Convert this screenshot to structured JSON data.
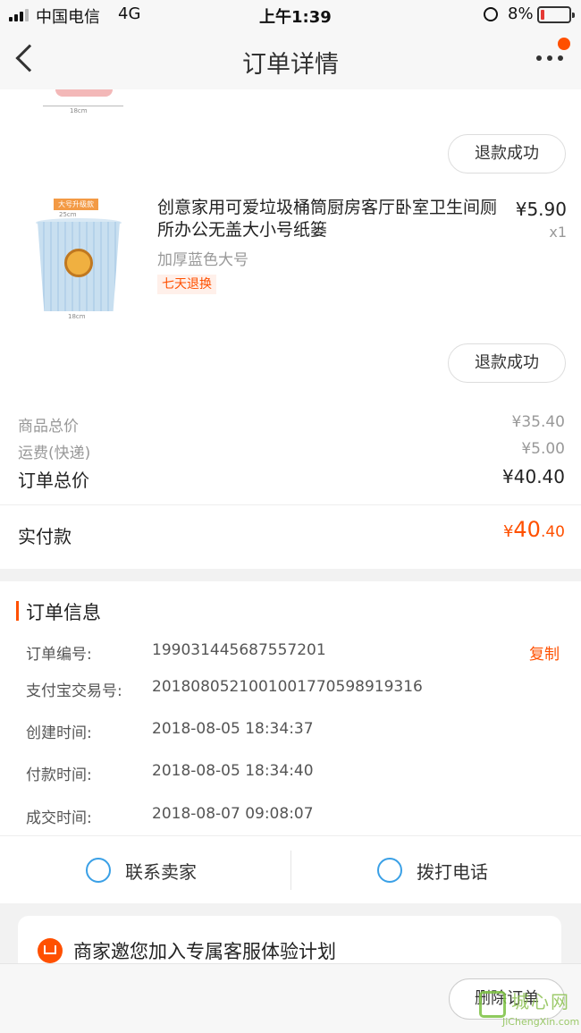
{
  "status": {
    "carrier": "中国电信",
    "network": "4G",
    "time": "上午1:39",
    "battery": "8%"
  },
  "nav": {
    "title": "订单详情"
  },
  "prev_item": {
    "dim": "18cm",
    "refund": "退款成功"
  },
  "item": {
    "title": "创意家用可爱垃圾桶筒厨房客厅卧室卫生间厕所办公无盖大小号纸篓",
    "price": "¥5.90",
    "qty": "x1",
    "sku": "加厚蓝色大号",
    "badge": "七天退换",
    "img_tag": "大号升级款",
    "img_dim_top": "25cm",
    "img_dim_bottom": "18cm",
    "refund": "退款成功"
  },
  "summary": {
    "goods_label": "商品总价",
    "goods_value": "¥35.40",
    "ship_label": "运费(快递)",
    "ship_value": "¥5.00",
    "total_label": "订单总价",
    "total_value": "¥40.40",
    "paid_label": "实付款",
    "paid_currency": "¥",
    "paid_int": "40",
    "paid_dec": ".40"
  },
  "order_info": {
    "title": "订单信息",
    "copy": "复制",
    "rows": [
      {
        "label": "订单编号:",
        "value": "199031445687557201"
      },
      {
        "label": "支付宝交易号:",
        "value": "2018080521001001770598919316"
      },
      {
        "label": "创建时间:",
        "value": "2018-08-05 18:34:37"
      },
      {
        "label": "付款时间:",
        "value": "2018-08-05 18:34:40"
      },
      {
        "label": "成交时间:",
        "value": "2018-08-07 09:08:07"
      }
    ]
  },
  "actions": {
    "contact": "联系卖家",
    "call": "拨打电话"
  },
  "invite": {
    "text": "商家邀您加入专属客服体验计划"
  },
  "bottom": {
    "delete": "删除订单"
  },
  "watermark": {
    "cn": "城心网",
    "en": "JiChengXin.com"
  },
  "colors": {
    "accent": "#ff5000",
    "icon_blue": "#3aa0e6"
  }
}
